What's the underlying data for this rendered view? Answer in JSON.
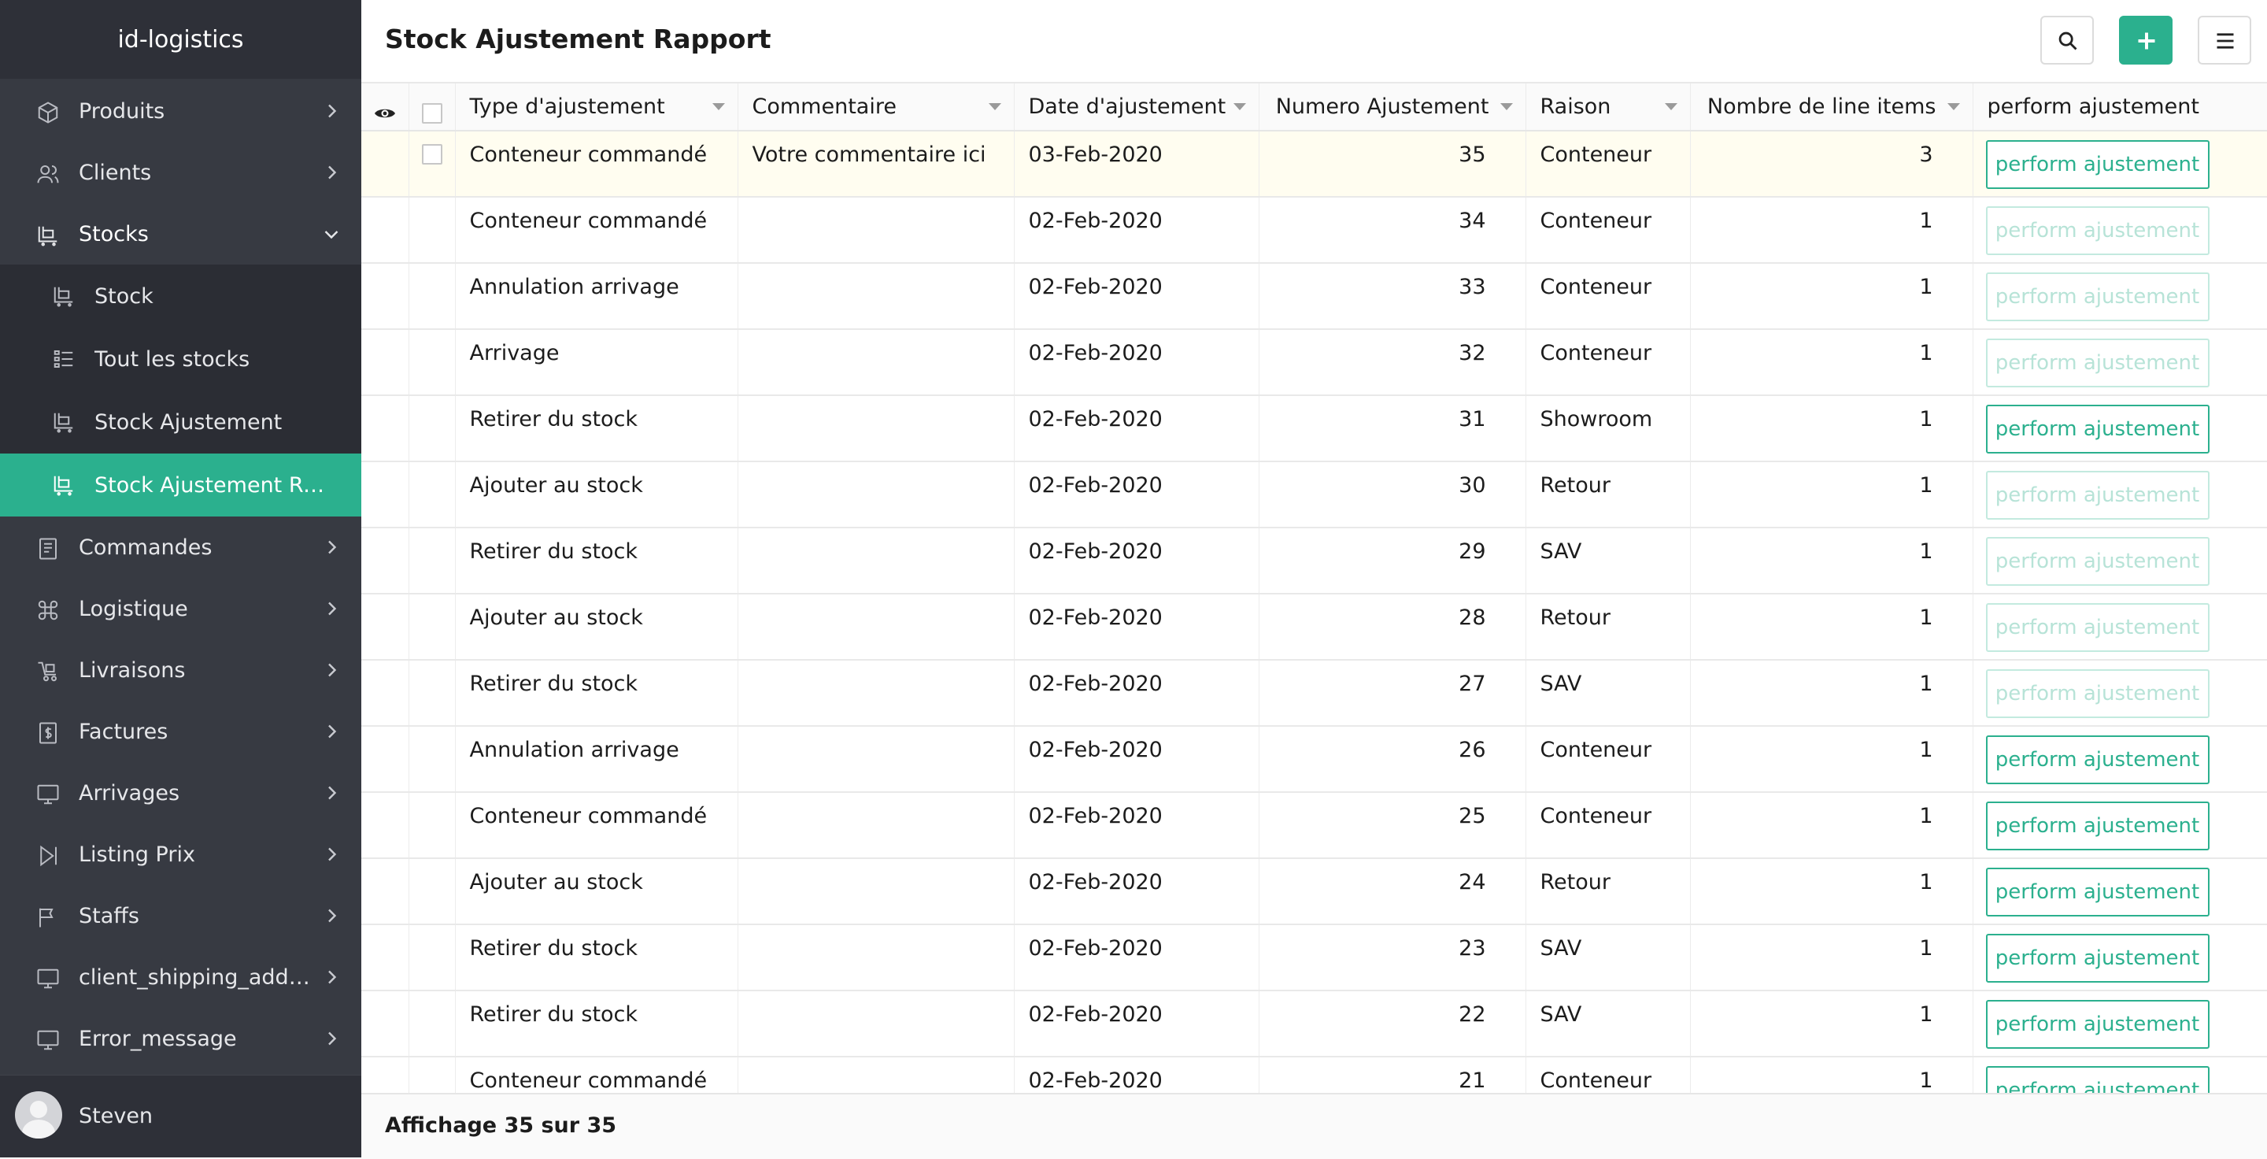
{
  "app": {
    "brand": "id-logistics"
  },
  "sidebar": {
    "items": [
      {
        "label": "Produits",
        "icon": "box-icon",
        "expandable": true
      },
      {
        "label": "Clients",
        "icon": "users-icon",
        "expandable": true
      },
      {
        "label": "Stocks",
        "icon": "stock-icon",
        "expanded": true,
        "children": [
          {
            "label": "Stock",
            "icon": "stock-icon"
          },
          {
            "label": "Tout les stocks",
            "icon": "list-icon"
          },
          {
            "label": "Stock Ajustement",
            "icon": "stock-icon"
          },
          {
            "label": "Stock Ajustement Ra...",
            "icon": "stock-icon",
            "active": true
          }
        ]
      },
      {
        "label": "Commandes",
        "icon": "receipt-icon",
        "expandable": true
      },
      {
        "label": "Logistique",
        "icon": "command-icon",
        "expandable": true
      },
      {
        "label": "Livraisons",
        "icon": "delivery-icon",
        "expandable": true
      },
      {
        "label": "Factures",
        "icon": "invoice-icon",
        "expandable": true
      },
      {
        "label": "Arrivages",
        "icon": "monitor-icon",
        "expandable": true
      },
      {
        "label": "Listing Prix",
        "icon": "play-next-icon",
        "expandable": true
      },
      {
        "label": "Staffs",
        "icon": "flag-icon",
        "expandable": true
      },
      {
        "label": "client_shipping_addre...",
        "icon": "monitor-icon",
        "expandable": true
      },
      {
        "label": "Error_message",
        "icon": "monitor-icon",
        "expandable": true
      }
    ],
    "user": {
      "name": "Steven"
    }
  },
  "header": {
    "title": "Stock Ajustement Rapport",
    "buttons": [
      "search-icon",
      "plus-icon",
      "hamburger-menu-icon"
    ]
  },
  "table": {
    "columns": [
      {
        "key": "type",
        "label": "Type d'ajustement",
        "sortable": true
      },
      {
        "key": "comment",
        "label": "Commentaire",
        "sortable": true
      },
      {
        "key": "date",
        "label": "Date d'ajustement",
        "sortable": true
      },
      {
        "key": "numero",
        "label": "Numero Ajustement",
        "sortable": true
      },
      {
        "key": "raison",
        "label": "Raison",
        "sortable": true
      },
      {
        "key": "lines",
        "label": "Nombre de line items",
        "sortable": true
      },
      {
        "key": "action",
        "label": "perform ajustement",
        "sortable": false
      }
    ],
    "action_label": "perform ajustement",
    "rows": [
      {
        "type": "Conteneur commandé",
        "comment": "Votre commentaire ici",
        "date": "03-Feb-2020",
        "numero": "35",
        "raison": "Conteneur",
        "lines": "3",
        "action_enabled": true,
        "highlighted": true
      },
      {
        "type": "Conteneur commandé",
        "comment": "",
        "date": "02-Feb-2020",
        "numero": "34",
        "raison": "Conteneur",
        "lines": "1",
        "action_enabled": false
      },
      {
        "type": "Annulation arrivage",
        "comment": "",
        "date": "02-Feb-2020",
        "numero": "33",
        "raison": "Conteneur",
        "lines": "1",
        "action_enabled": false
      },
      {
        "type": "Arrivage",
        "comment": "",
        "date": "02-Feb-2020",
        "numero": "32",
        "raison": "Conteneur",
        "lines": "1",
        "action_enabled": false
      },
      {
        "type": "Retirer du stock",
        "comment": "",
        "date": "02-Feb-2020",
        "numero": "31",
        "raison": "Showroom",
        "lines": "1",
        "action_enabled": true
      },
      {
        "type": "Ajouter au stock",
        "comment": "",
        "date": "02-Feb-2020",
        "numero": "30",
        "raison": "Retour",
        "lines": "1",
        "action_enabled": false
      },
      {
        "type": "Retirer du stock",
        "comment": "",
        "date": "02-Feb-2020",
        "numero": "29",
        "raison": "SAV",
        "lines": "1",
        "action_enabled": false
      },
      {
        "type": "Ajouter au stock",
        "comment": "",
        "date": "02-Feb-2020",
        "numero": "28",
        "raison": "Retour",
        "lines": "1",
        "action_enabled": false
      },
      {
        "type": "Retirer du stock",
        "comment": "",
        "date": "02-Feb-2020",
        "numero": "27",
        "raison": "SAV",
        "lines": "1",
        "action_enabled": false
      },
      {
        "type": "Annulation arrivage",
        "comment": "",
        "date": "02-Feb-2020",
        "numero": "26",
        "raison": "Conteneur",
        "lines": "1",
        "action_enabled": true
      },
      {
        "type": "Conteneur commandé",
        "comment": "",
        "date": "02-Feb-2020",
        "numero": "25",
        "raison": "Conteneur",
        "lines": "1",
        "action_enabled": true
      },
      {
        "type": "Ajouter au stock",
        "comment": "",
        "date": "02-Feb-2020",
        "numero": "24",
        "raison": "Retour",
        "lines": "1",
        "action_enabled": true
      },
      {
        "type": "Retirer du stock",
        "comment": "",
        "date": "02-Feb-2020",
        "numero": "23",
        "raison": "SAV",
        "lines": "1",
        "action_enabled": true
      },
      {
        "type": "Retirer du stock",
        "comment": "",
        "date": "02-Feb-2020",
        "numero": "22",
        "raison": "SAV",
        "lines": "1",
        "action_enabled": true
      },
      {
        "type": "Conteneur commandé",
        "comment": "",
        "date": "02-Feb-2020",
        "numero": "21",
        "raison": "Conteneur",
        "lines": "1",
        "action_enabled": true
      }
    ]
  },
  "footer": {
    "text": "Affichage 35 sur 35"
  },
  "colors": {
    "accent": "#2bb08e",
    "sidebar_bg": "#373a42",
    "sidebar_sub_bg": "#2b2d34",
    "highlight_row": "#fffdf0"
  }
}
